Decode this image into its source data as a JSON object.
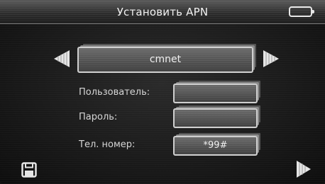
{
  "header": {
    "title": "Установить APN",
    "battery_icon": "battery-icon"
  },
  "apn": {
    "value": "cmnet",
    "prev_icon": "arrow-left-icon",
    "next_icon": "arrow-right-icon"
  },
  "fields": {
    "user_label": "Пользователь:",
    "user_value": "",
    "password_label": "Пароль:",
    "password_value": "",
    "phone_label": "Тел. номер:",
    "phone_value": "*99#"
  },
  "footer": {
    "save_icon": "floppy-save-icon",
    "next_icon": "next-page-arrow-icon"
  }
}
